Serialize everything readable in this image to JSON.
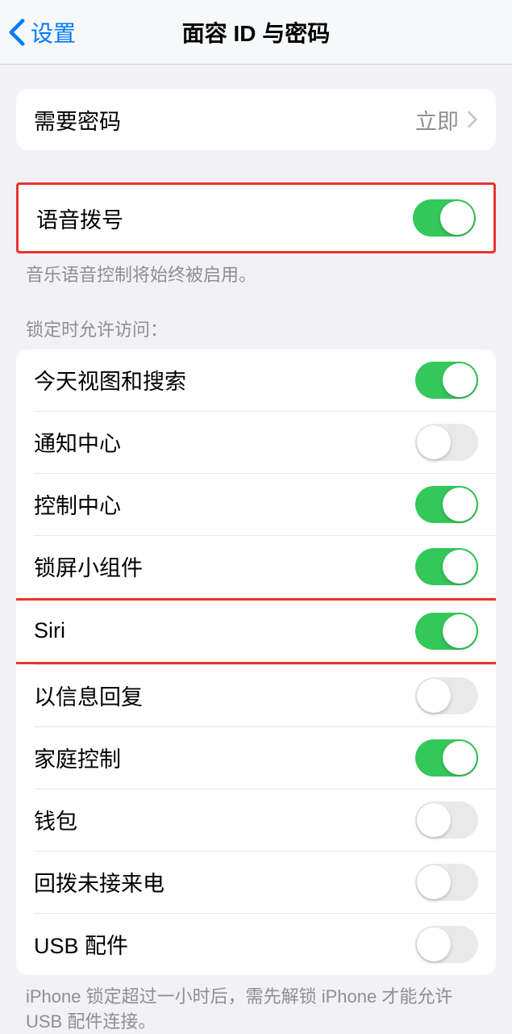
{
  "nav": {
    "back": "设置",
    "title": "面容 ID 与密码"
  },
  "passcode_row": {
    "label": "需要密码",
    "value": "立即"
  },
  "voice_dial": {
    "label": "语音拨号",
    "footer": "音乐语音控制将始终被启用。"
  },
  "lock_section": {
    "header": "锁定时允许访问：",
    "items": [
      {
        "label": "今天视图和搜索",
        "on": true
      },
      {
        "label": "通知中心",
        "on": false
      },
      {
        "label": "控制中心",
        "on": true
      },
      {
        "label": "锁屏小组件",
        "on": true
      },
      {
        "label": "Siri",
        "on": true
      },
      {
        "label": "以信息回复",
        "on": false
      },
      {
        "label": "家庭控制",
        "on": true
      },
      {
        "label": "钱包",
        "on": false
      },
      {
        "label": "回拨未接来电",
        "on": false
      },
      {
        "label": "USB 配件",
        "on": false
      }
    ],
    "footer": "iPhone 锁定超过一小时后，需先解锁 iPhone 才能允许 USB 配件连接。"
  }
}
